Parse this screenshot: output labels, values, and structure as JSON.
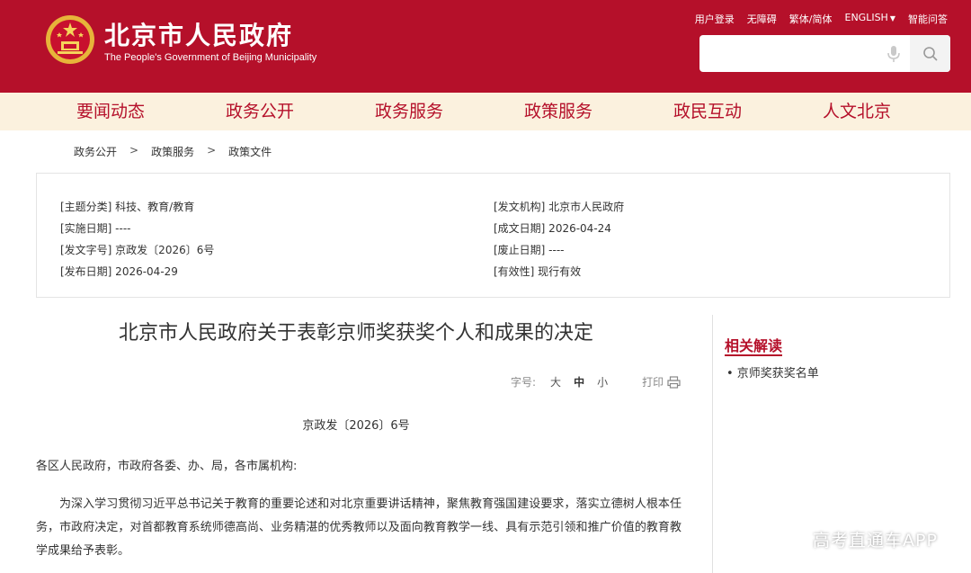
{
  "header": {
    "site_title": "北京市人民政府",
    "site_subtitle": "The People's Government of Beijing Municipality",
    "top_links": {
      "login": "用户登录",
      "accessibility": "无障碍",
      "traditional": "繁体/简体",
      "english": "ENGLISH",
      "qa": "智能问答"
    },
    "search": {
      "placeholder": ""
    },
    "brand_color": "#b5102a"
  },
  "nav": {
    "items": [
      "要闻动态",
      "政务公开",
      "政务服务",
      "政策服务",
      "政民互动",
      "人文北京"
    ]
  },
  "breadcrumb": [
    "政务公开",
    "政策服务",
    "政策文件"
  ],
  "breadcrumb_sep": ">",
  "meta": {
    "left": [
      "[主题分类] 科技、教育/教育",
      "[实施日期] ----",
      "[发文字号] 京政发〔2026〕6号",
      "[发布日期] 2026-04-29"
    ],
    "right": [
      "[发文机构] 北京市人民政府",
      "[成文日期] 2026-04-24",
      "[废止日期] ----",
      "[有效性] 现行有效"
    ]
  },
  "article": {
    "title": "北京市人民政府关于表彰京师奖获奖个人和成果的决定",
    "tools": {
      "font_size_label": "字号:",
      "large": "大",
      "medium": "中",
      "small": "小",
      "print": "打印"
    },
    "doc_number": "京政发〔2026〕6号",
    "addressee": "各区人民政府，市政府各委、办、局，各市属机构:",
    "paragraph": "为深入学习贯彻习近平总书记关于教育的重要论述和对北京重要讲话精神，聚焦教育强国建设要求，落实立德树人根本任务，市政府决定，对首都教育系统师德高尚、业务精湛的优秀教师以及面向教育教学一线、具有示范引领和推广价值的教育教学成果给予表彰。"
  },
  "sidebar": {
    "title": "相关解读",
    "items": [
      "• 京师奖获奖名单"
    ]
  },
  "watermark": "高考直通车APP"
}
